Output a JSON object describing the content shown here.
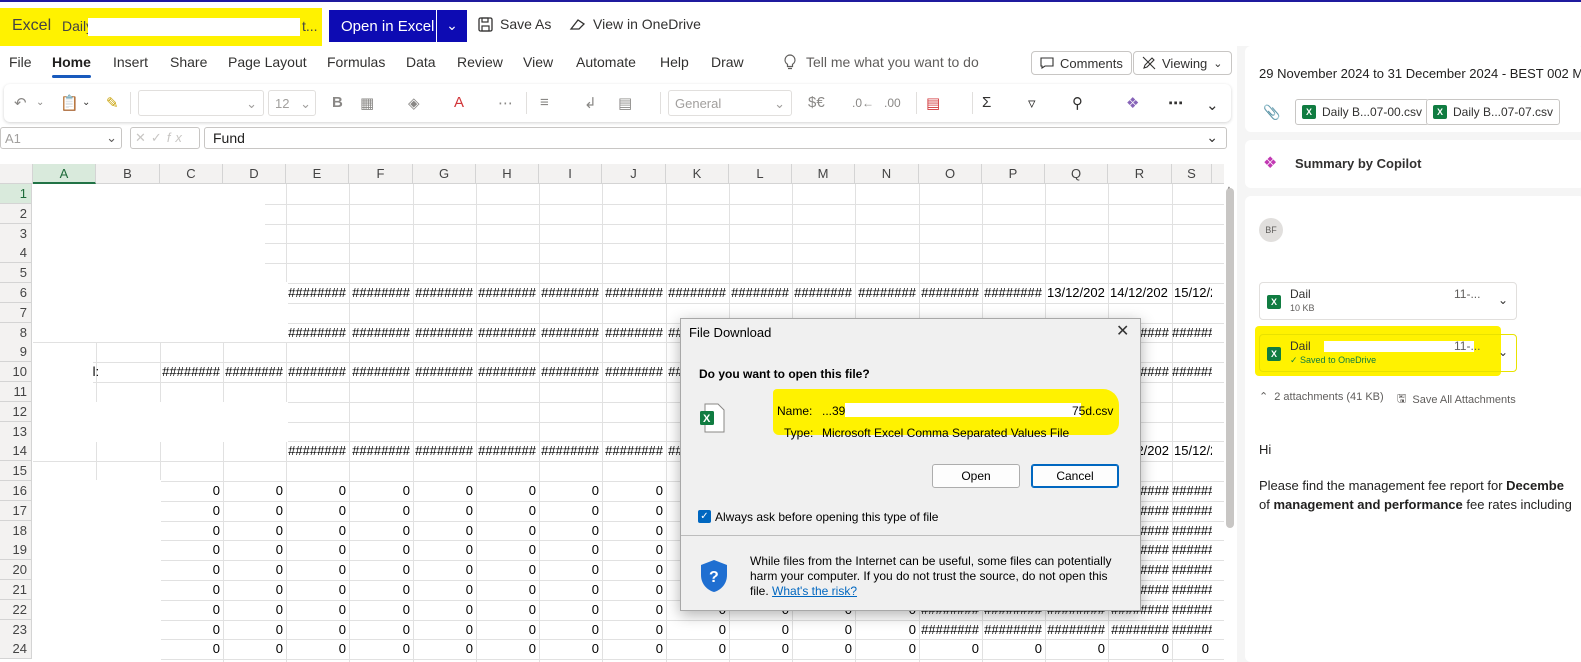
{
  "topbar": {
    "app_name": "Excel",
    "file_name_start": "Daily",
    "file_name_end": "t...",
    "open_in_excel": "Open in Excel",
    "save_as": "Save As",
    "view_onedrive": "View in OneDrive",
    "highlight_color": "#fff200",
    "accent_color": "#0d0bb3"
  },
  "ribbon": {
    "tabs": [
      "File",
      "Home",
      "Insert",
      "Share",
      "Page Layout",
      "Formulas",
      "Data",
      "Review",
      "View",
      "Automate",
      "Help",
      "Draw"
    ],
    "active_tab": "Home",
    "tell_me": "Tell me what you want to do",
    "comments": "Comments",
    "viewing": "Viewing",
    "font_size": "12",
    "number_format": "General"
  },
  "formula_bar": {
    "name_box": "A1",
    "formula": "Fund"
  },
  "grid": {
    "columns": [
      "A",
      "B",
      "C",
      "D",
      "E",
      "F",
      "G",
      "H",
      "I",
      "J",
      "K",
      "L",
      "M",
      "N",
      "O",
      "P",
      "Q",
      "R",
      "S"
    ],
    "rows": [
      "1",
      "2",
      "3",
      "4",
      "5",
      "6",
      "7",
      "8",
      "9",
      "10",
      "11",
      "12",
      "13",
      "14",
      "15",
      "16",
      "17",
      "18",
      "19",
      "20",
      "21",
      "22",
      "23",
      "24"
    ],
    "hash": "########",
    "hash_short": "###",
    "total_label": "Total:",
    "date_q6": "13/12/202",
    "date_r6": "14/12/202",
    "date_s6": "15/12/2",
    "date_r14": "2/202",
    "date_s14": "15/12/2",
    "zero": "0"
  },
  "pane": {
    "subject": "29 November 2024 to 31 December 2024 - BEST 002 Man",
    "att_btn1": "Daily B...07-00.csv",
    "att_btn2": "Daily B...07-07.csv",
    "copilot": "Summary by Copilot",
    "avatar": "BF",
    "att1_name": "Dail",
    "att1_size": "10 KB",
    "att1_dots": "11-...",
    "att2_name": "Dail",
    "att2_saved": "Saved to OneDrive",
    "att2_dots": "11-...",
    "att_count": "2 attachments (41 KB)",
    "save_all": "Save All Attachments",
    "greeting": "Hi",
    "body_1": "Please find the management fee report for ",
    "body_1_bold": "Decembe",
    "body_2_pre": "of ",
    "body_2_bold": "management and performance",
    "body_2_post": " fee rates including"
  },
  "dialog": {
    "title": "File Download",
    "question": "Do you want to open this file?",
    "name_label": "Name:",
    "name_start": "...39c",
    "name_end": "75d.csv",
    "type_label": "Type:",
    "type_value": "Microsoft Excel Comma Separated Values File",
    "open": "Open",
    "cancel": "Cancel",
    "always_ask": "Always ask before opening this type of file",
    "warning": "While files from the Internet can be useful, some files can potentially harm your computer. If you do not trust the source, do not open this file.",
    "risk_link": "What's the risk?"
  }
}
